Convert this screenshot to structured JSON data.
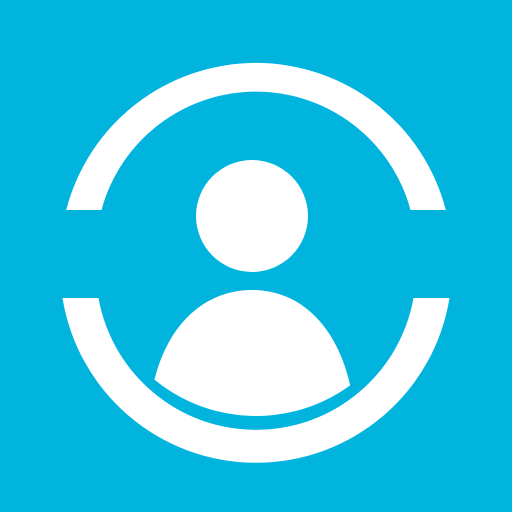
{
  "icon": {
    "name": "user-account-icon",
    "background_color": "#00b4de",
    "foreground_color": "#ffffff"
  }
}
